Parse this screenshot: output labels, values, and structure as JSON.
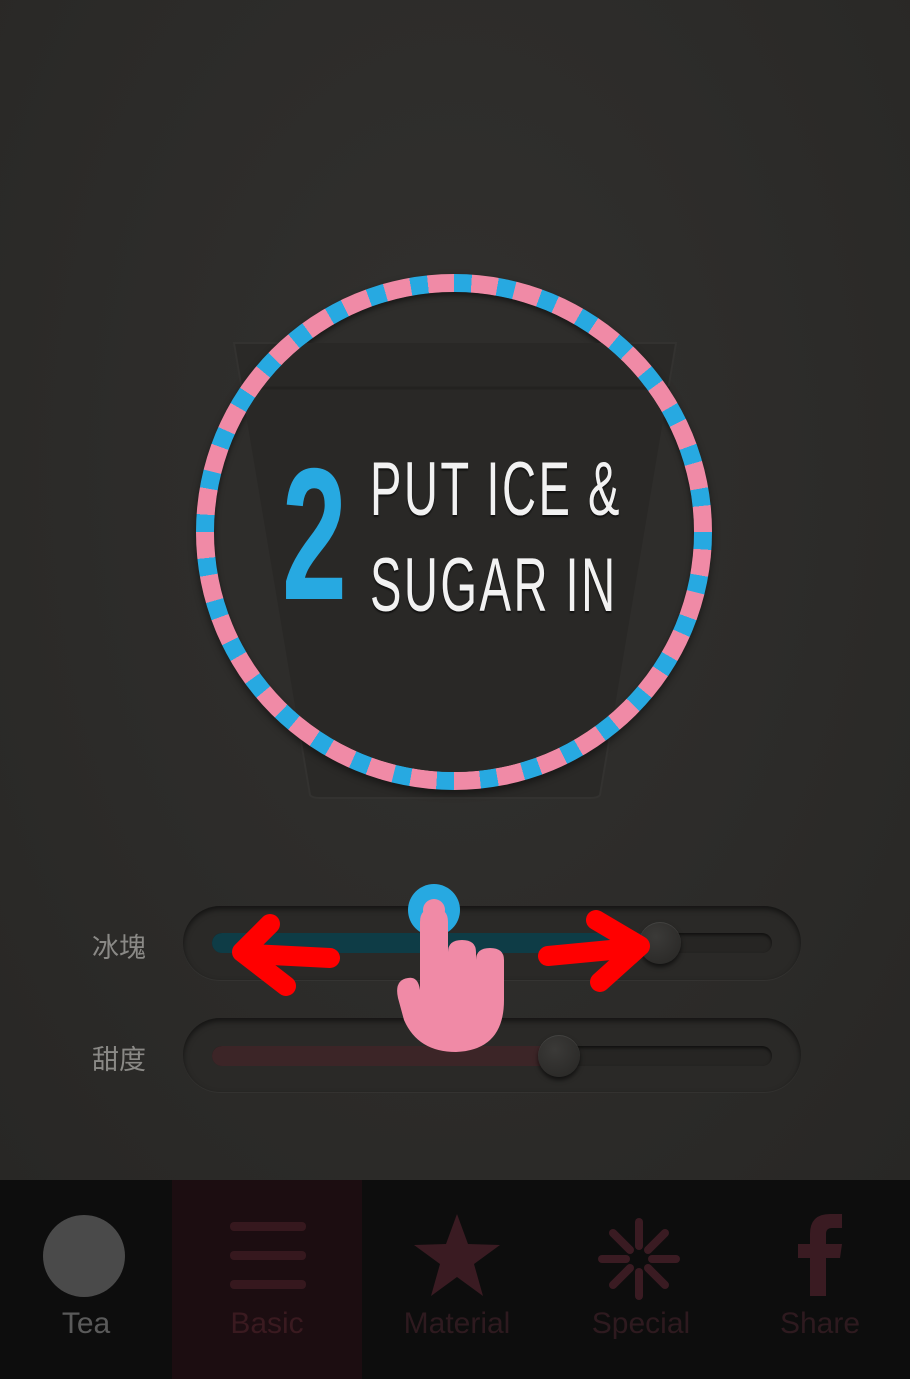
{
  "instruction": {
    "step_number": "2",
    "line1": "PUT ICE &",
    "line2": "SUGAR IN"
  },
  "sliders": [
    {
      "label": "冰塊",
      "value": 0.8,
      "fill_color": "#0e3c46"
    },
    {
      "label": "甜度",
      "value": 0.62,
      "fill_color": "#3c2527"
    }
  ],
  "tabs": [
    {
      "label": "Tea",
      "icon": "circle-icon",
      "color": "#4a4a4a",
      "active": false
    },
    {
      "label": "Basic",
      "icon": "menu-lines-icon",
      "color": "#36181e",
      "active": true
    },
    {
      "label": "Material",
      "icon": "star-icon",
      "color": "#3a1b22",
      "active": false
    },
    {
      "label": "Special",
      "icon": "asterisk-icon",
      "color": "#3a1b22",
      "active": false
    },
    {
      "label": "Share",
      "icon": "facebook-icon",
      "color": "#3a1b22",
      "active": false
    }
  ],
  "colors": {
    "ring_blue": "#27a9e1",
    "ring_pink": "#f08aa6",
    "hint_arrow": "#ff0000",
    "hint_hand": "#f08aa6"
  }
}
